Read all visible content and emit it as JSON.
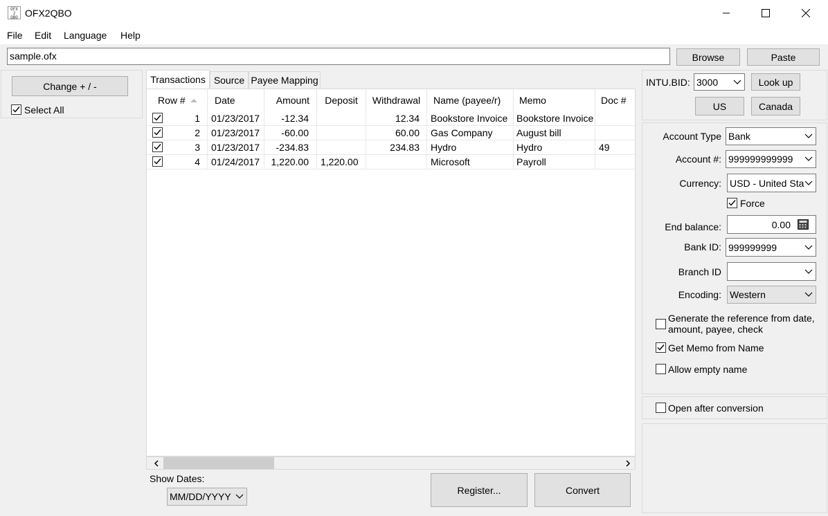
{
  "window": {
    "title": "OFX2QBO"
  },
  "menu": {
    "file": "File",
    "edit": "Edit",
    "language": "Language",
    "help": "Help"
  },
  "file_input": {
    "value": "sample.ofx"
  },
  "top_buttons": {
    "browse": "Browse",
    "paste": "Paste"
  },
  "left_panel": {
    "change_sign": "Change + / -",
    "select_all": "Select All",
    "select_all_checked": true
  },
  "tabs": [
    "Transactions",
    "Source",
    "Payee Mapping"
  ],
  "active_tab": "Transactions",
  "table": {
    "columns": [
      "Row #",
      "Date",
      "Amount",
      "Deposit",
      "Withdrawal",
      "Name (payee/r)",
      "Memo",
      "Doc #"
    ],
    "rows": [
      {
        "checked": true,
        "row": "1",
        "date": "01/23/2017",
        "amount": "-12.34",
        "deposit": "",
        "withdrawal": "12.34",
        "name": "Bookstore Invoice",
        "memo": "Bookstore Invoice",
        "doc": ""
      },
      {
        "checked": true,
        "row": "2",
        "date": "01/23/2017",
        "amount": "-60.00",
        "deposit": "",
        "withdrawal": "60.00",
        "name": "Gas Company",
        "memo": "August bill",
        "doc": ""
      },
      {
        "checked": true,
        "row": "3",
        "date": "01/23/2017",
        "amount": "-234.83",
        "deposit": "",
        "withdrawal": "234.83",
        "name": "Hydro",
        "memo": "Hydro",
        "doc": "49"
      },
      {
        "checked": true,
        "row": "4",
        "date": "01/24/2017",
        "amount": "1,220.00",
        "deposit": "1,220.00",
        "withdrawal": "",
        "name": "Microsoft",
        "memo": "Payroll",
        "doc": ""
      }
    ]
  },
  "bottom": {
    "show_dates_label": "Show Dates:",
    "date_format": "MM/DD/YYYY",
    "register": "Register...",
    "convert": "Convert"
  },
  "intu": {
    "label": "INTU.BID:",
    "value": "3000",
    "lookup": "Look up",
    "us": "US",
    "canada": "Canada"
  },
  "settings": {
    "account_type_label": "Account Type",
    "account_type": "Bank",
    "account_num_label": "Account #:",
    "account_num": "999999999999",
    "currency_label": "Currency:",
    "currency": "USD - United Sta",
    "force_label": "Force",
    "force_checked": true,
    "end_balance_label": "End balance:",
    "end_balance": "0.00",
    "bank_id_label": "Bank ID:",
    "bank_id": "999999999",
    "branch_id_label": "Branch ID",
    "branch_id": "",
    "encoding_label": "Encoding:",
    "encoding": "Western",
    "gen_ref_line1": "Generate the reference from date,",
    "gen_ref_line2": "amount, payee, check",
    "gen_ref_checked": false,
    "memo_from_name": "Get Memo from Name",
    "memo_from_name_checked": true,
    "allow_empty": "Allow empty name",
    "allow_empty_checked": false
  },
  "open_after": {
    "label": "Open after conversion",
    "checked": false
  }
}
